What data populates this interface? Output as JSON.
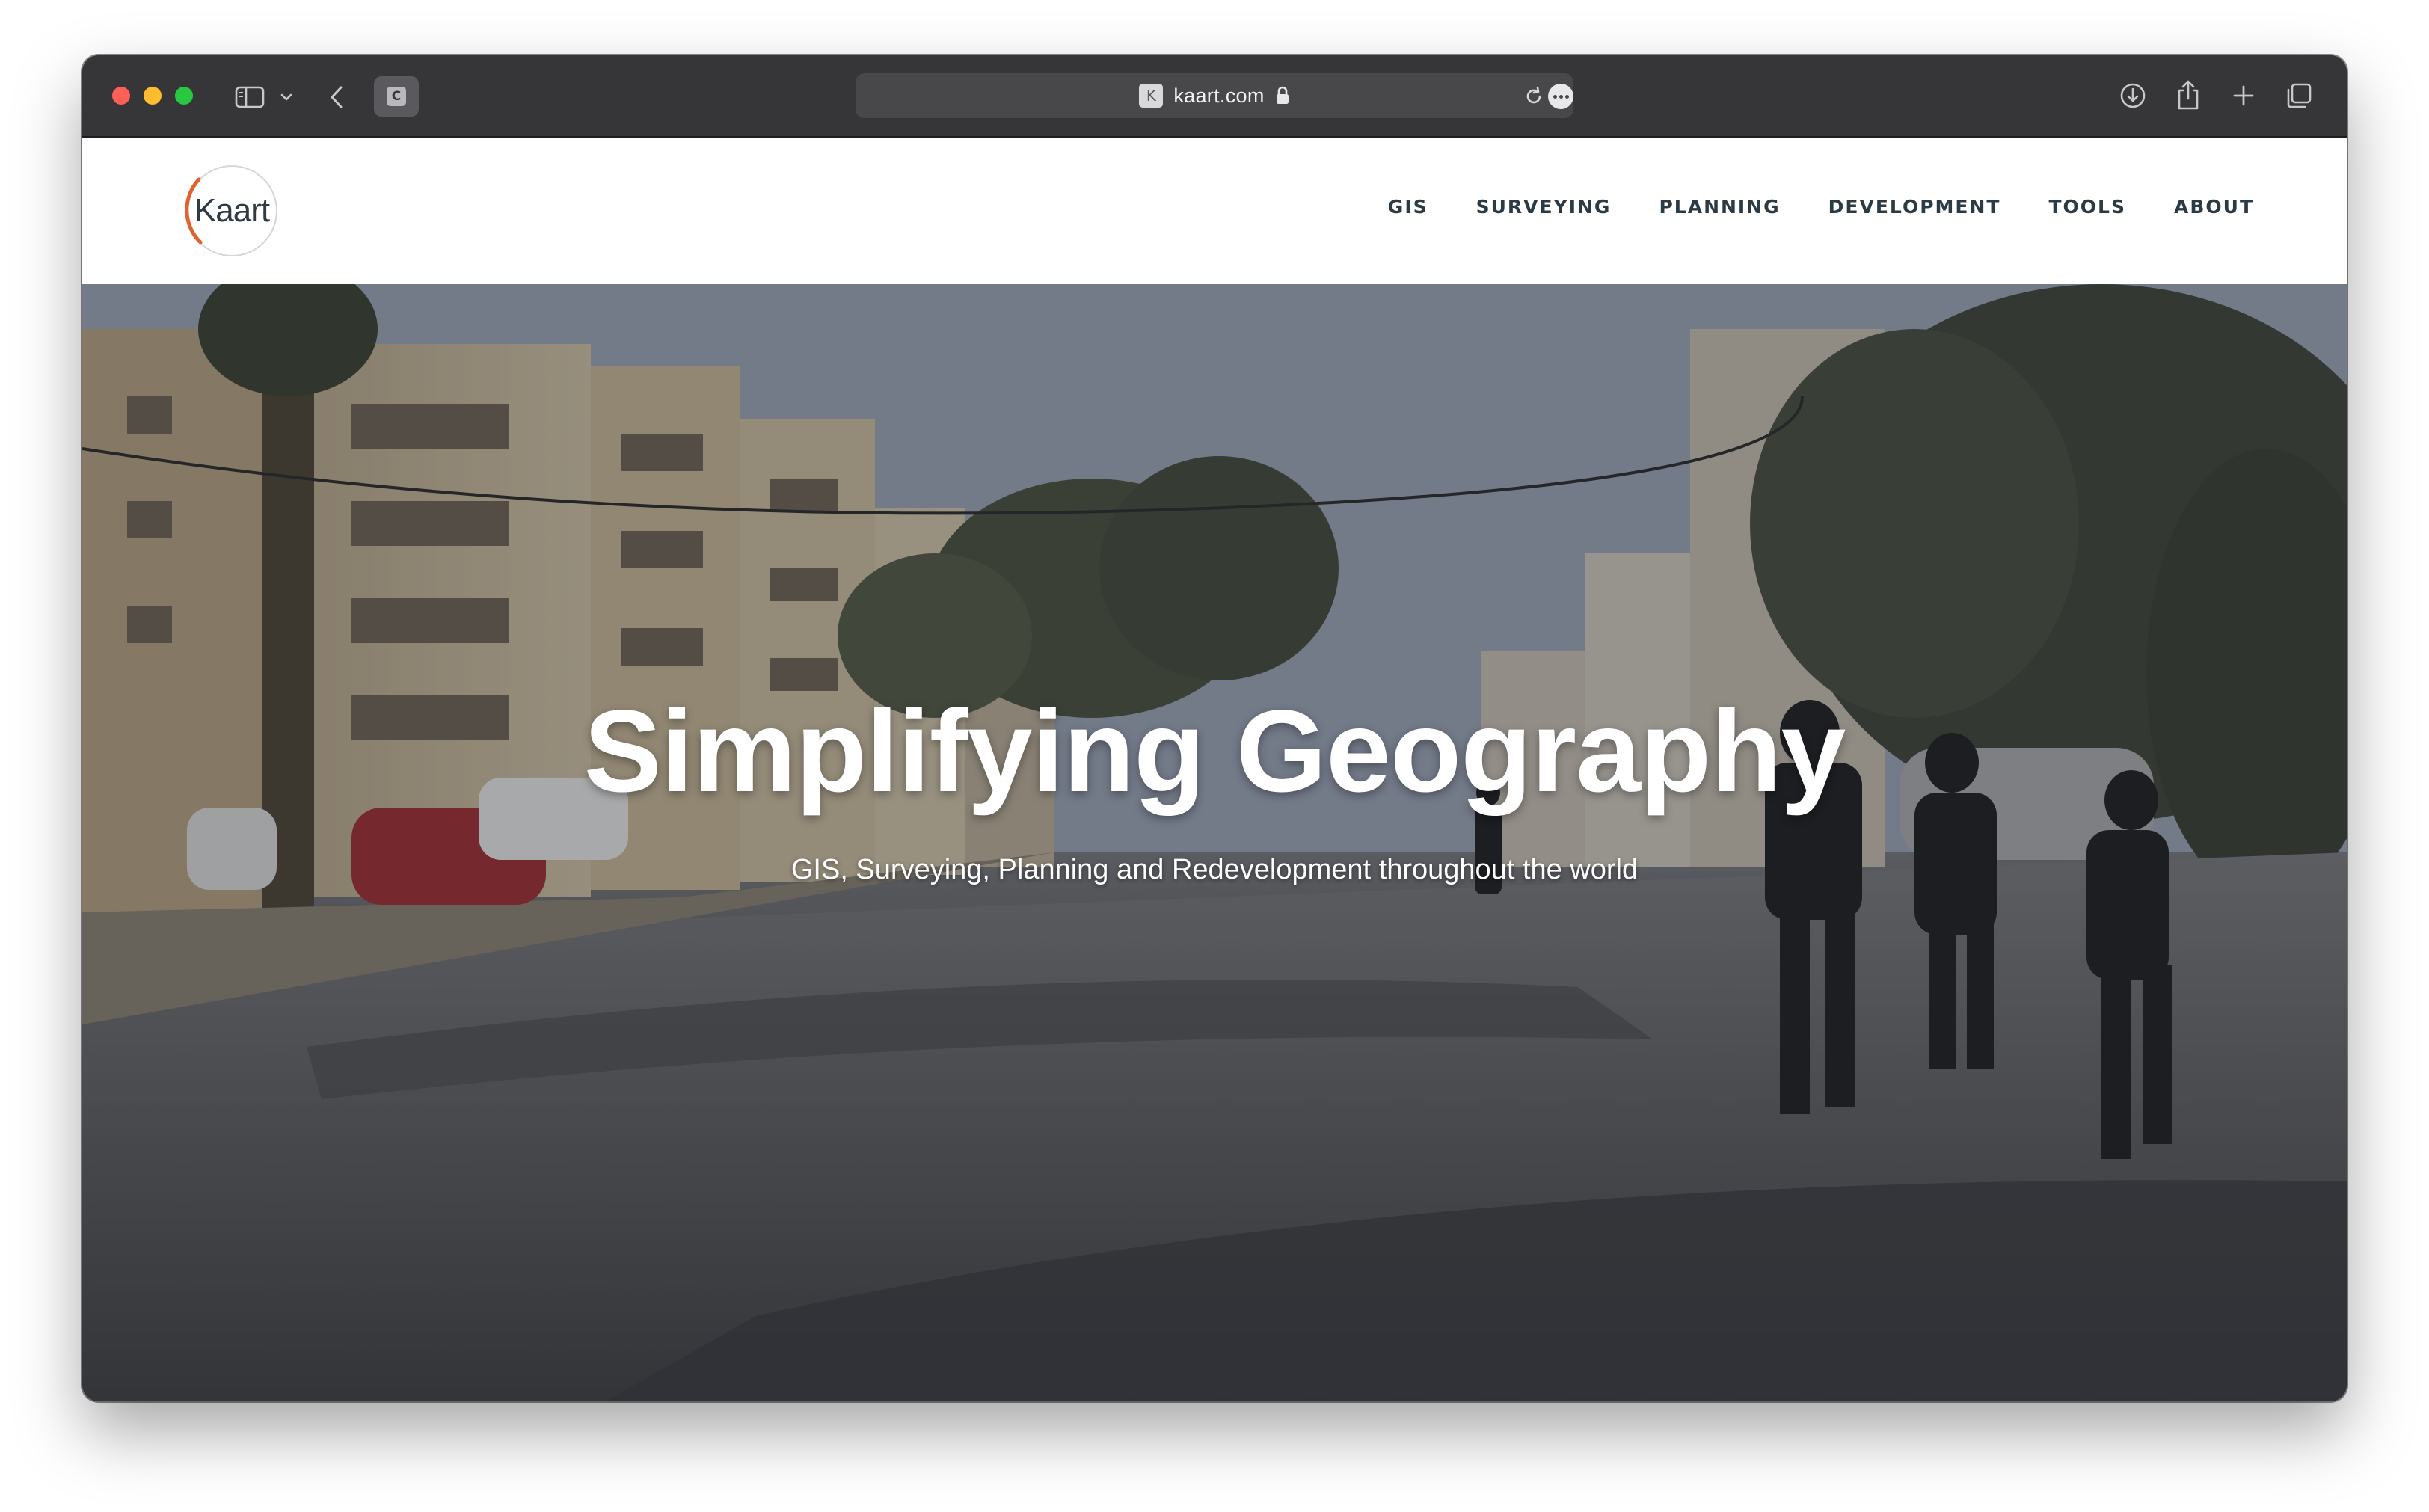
{
  "browser": {
    "url": "kaart.com",
    "tab_favicon_letter": "C",
    "site_favicon_letter": "K"
  },
  "site": {
    "logo_text": "Kaart",
    "brand_color": "#e0622c",
    "nav": [
      {
        "label": "GIS"
      },
      {
        "label": "SURVEYING"
      },
      {
        "label": "PLANNING"
      },
      {
        "label": "DEVELOPMENT"
      },
      {
        "label": "TOOLS"
      },
      {
        "label": "ABOUT"
      }
    ]
  },
  "hero": {
    "title": "Simplifying Geography",
    "subtitle": "GIS, Surveying, Planning and Redevelopment throughout the world"
  },
  "icons": [
    "sidebar-icon",
    "chevron-down-icon",
    "back-arrow-icon",
    "lock-icon",
    "reload-icon",
    "more-icon",
    "download-icon",
    "share-icon",
    "plus-icon",
    "tabs-overview-icon"
  ]
}
